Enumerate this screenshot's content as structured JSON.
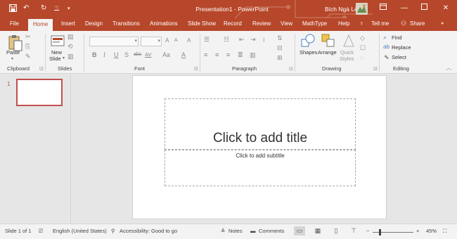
{
  "titlebar": {
    "title": "Presentation1  -  PowerPoint",
    "user": "Bích Ngà Lê",
    "save_icon": "save-icon",
    "undo_icon": "undo-icon",
    "redo_icon": "redo-icon",
    "customize_icon": "customize-qat-icon",
    "ribbon_display_icon": "ribbon-display-options-icon",
    "minimize_icon": "minimize-icon",
    "maximize_icon": "maximize-icon",
    "close_icon": "close-icon",
    "accent_color": "#b7472a"
  },
  "tabs": [
    "File",
    "Home",
    "Insert",
    "Design",
    "Transitions",
    "Animations",
    "Slide Show",
    "Record",
    "Review",
    "View",
    "MathType",
    "Help"
  ],
  "active_tab": "Home",
  "tell_me": "Tell me",
  "share": "Share",
  "ribbon": {
    "clipboard": {
      "label": "Clipboard",
      "paste": "Paste"
    },
    "slides": {
      "label": "Slides",
      "new_slide_line1": "New",
      "new_slide_line2": "Slide"
    },
    "font": {
      "label": "Font",
      "font_name": "",
      "font_size": "",
      "bold": "B",
      "italic": "I",
      "underline": "U",
      "strike": "S",
      "shadow": "abc",
      "spacing": "AV",
      "case": "Aa",
      "grow": "A",
      "shrink": "A",
      "clear": "A"
    },
    "paragraph": {
      "label": "Paragraph"
    },
    "drawing": {
      "label": "Drawing",
      "shapes": "Shapes",
      "arrange": "Arrange",
      "quick_styles_1": "Quick",
      "quick_styles_2": "Styles"
    },
    "editing": {
      "label": "Editing",
      "find": "Find",
      "replace": "Replace",
      "select": "Select"
    }
  },
  "slide_pane": {
    "number": "1"
  },
  "slide": {
    "title_placeholder": "Click to add title",
    "subtitle_placeholder": "Click to add subtitle"
  },
  "status": {
    "slide_info": "Slide 1 of 1",
    "language": "English (United States)",
    "accessibility": "Accessibility: Good to go",
    "notes": "Notes",
    "comments": "Comments",
    "zoom_minus": "−",
    "zoom_plus": "+",
    "zoom": "45%"
  }
}
